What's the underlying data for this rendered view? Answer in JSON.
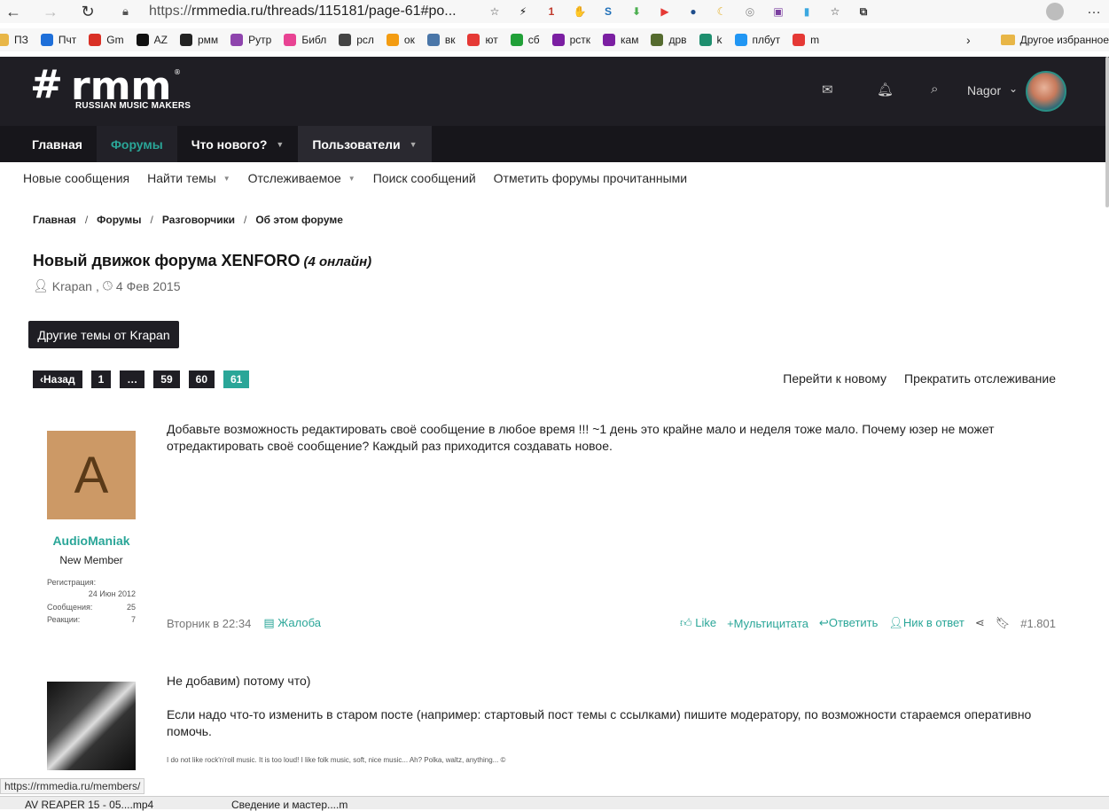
{
  "browser": {
    "url_scheme": "https://",
    "url_rest": "rmmedia.ru/threads/115181/page-61#po...",
    "extensions": [
      {
        "name": "star-icon",
        "glyph": "☆",
        "color": "#444"
      },
      {
        "name": "bolt-icon",
        "glyph": "⚡",
        "color": "#111"
      },
      {
        "name": "extension-badge-icon",
        "glyph": "1",
        "color": "#c0392b"
      },
      {
        "name": "adblock-icon",
        "glyph": "✋",
        "color": "#e53935"
      },
      {
        "name": "s-extension-icon",
        "glyph": "S",
        "color": "#1e6fb8"
      },
      {
        "name": "download-icon",
        "glyph": "⬇",
        "color": "#4caf50"
      },
      {
        "name": "youtube-ext-icon",
        "glyph": "▶",
        "color": "#e53935"
      },
      {
        "name": "globe-blue-icon",
        "glyph": "●",
        "color": "#1f4e8c"
      },
      {
        "name": "moon-icon",
        "glyph": "☾",
        "color": "#e5b22d"
      },
      {
        "name": "globe-grey-icon",
        "glyph": "◎",
        "color": "#888"
      },
      {
        "name": "palette-icon",
        "glyph": "▣",
        "color": "#7b3fa0"
      },
      {
        "name": "trash-icon",
        "glyph": "▮",
        "color": "#3ba8e0"
      },
      {
        "name": "favorites-icon",
        "glyph": "☆",
        "color": "#333"
      },
      {
        "name": "collections-icon",
        "glyph": "⧉",
        "color": "#333"
      }
    ]
  },
  "bookmarks": {
    "items": [
      {
        "label": "ПЗ",
        "color": "#e8b647"
      },
      {
        "label": "Пчт",
        "color": "#1e6fd9"
      },
      {
        "label": "Gm",
        "color": "#d93025"
      },
      {
        "label": "AZ",
        "color": "#111111"
      },
      {
        "label": "рмм",
        "color": "#222222"
      },
      {
        "label": "Рутр",
        "color": "#8e44ad"
      },
      {
        "label": "Библ",
        "color": "#e84393"
      },
      {
        "label": "рсл",
        "color": "#444444"
      },
      {
        "label": "ок",
        "color": "#f39c12"
      },
      {
        "label": "вк",
        "color": "#4a76a8"
      },
      {
        "label": "ют",
        "color": "#e53935"
      },
      {
        "label": "сб",
        "color": "#21a038"
      },
      {
        "label": "рстк",
        "color": "#7b1fa2"
      },
      {
        "label": "кам",
        "color": "#7b1fa2"
      },
      {
        "label": "дрв",
        "color": "#556b2f"
      },
      {
        "label": "k",
        "color": "#1e8e6e"
      },
      {
        "label": "плбут",
        "color": "#2196f3"
      },
      {
        "label": "m",
        "color": "#e53935"
      }
    ],
    "other": "Другое избранное"
  },
  "header": {
    "logo_sub": "RUSSIAN MUSIC MAKERS",
    "user_name": "Nagor"
  },
  "nav": {
    "tabs": [
      {
        "label": "Главная"
      },
      {
        "label": "Форумы"
      },
      {
        "label": "Что нового?"
      },
      {
        "label": "Пользователи"
      }
    ]
  },
  "subnav": {
    "items": [
      {
        "label": "Новые сообщения"
      },
      {
        "label": "Найти темы"
      },
      {
        "label": "Отслеживаемое"
      },
      {
        "label": "Поиск сообщений"
      },
      {
        "label": "Отметить форумы прочитанными"
      }
    ]
  },
  "breadcrumb": [
    "Главная",
    "Форумы",
    "Разговорчики",
    "Об этом форуме"
  ],
  "thread": {
    "title": "Новый движок форума XENFORO",
    "online": "(4 онлайн)",
    "author": "Krapan",
    "date": "4 Фев 2015",
    "other_topics": "Другие темы от Krapan"
  },
  "pager": {
    "prev": "Назад",
    "pages": [
      "1",
      "…",
      "59",
      "60",
      "61"
    ],
    "go_new": "Перейти к новому",
    "unwatch": "Прекратить отслеживание"
  },
  "posts": [
    {
      "avatar_letter": "A",
      "username": "AudioManiak",
      "user_title": "New Member",
      "reg_label": "Регистрация:",
      "reg_value": "24 Июн 2012",
      "msgs_label": "Сообщения:",
      "msgs_value": "25",
      "reactions_label": "Реакции:",
      "reactions_value": "7",
      "text": "Добавьте возможность редактировать своё сообщение в любое время !!! ~1 день это крайне мало и неделя тоже мало. Почему юзер не может отредактировать своё сообщение? Каждый раз приходится создавать новое.",
      "time": "Вторник в 22:34",
      "report": "Жалоба",
      "like": "Like",
      "multiquote": "Мультицитата",
      "reply": "Ответить",
      "nick_reply": "Ник в ответ",
      "number": "#1.801"
    },
    {
      "line1": "Не добавим) потому что)",
      "line2": "Если надо что-то изменить в старом посте (например: стартовый пост темы с ссылками) пишите модератору, по возможности стараемся оперативно помочь.",
      "signature": "I do not like rock'n'roll music. It is too loud! I like folk music, soft, nice music... Ah? Polka, waltz, anything... ©"
    }
  ],
  "status": {
    "url": "https://rmmedia.ru/members/",
    "taskbar_1": "AV REAPER 15 - 05....mp4",
    "taskbar_2": "Сведение и мастер....m"
  }
}
